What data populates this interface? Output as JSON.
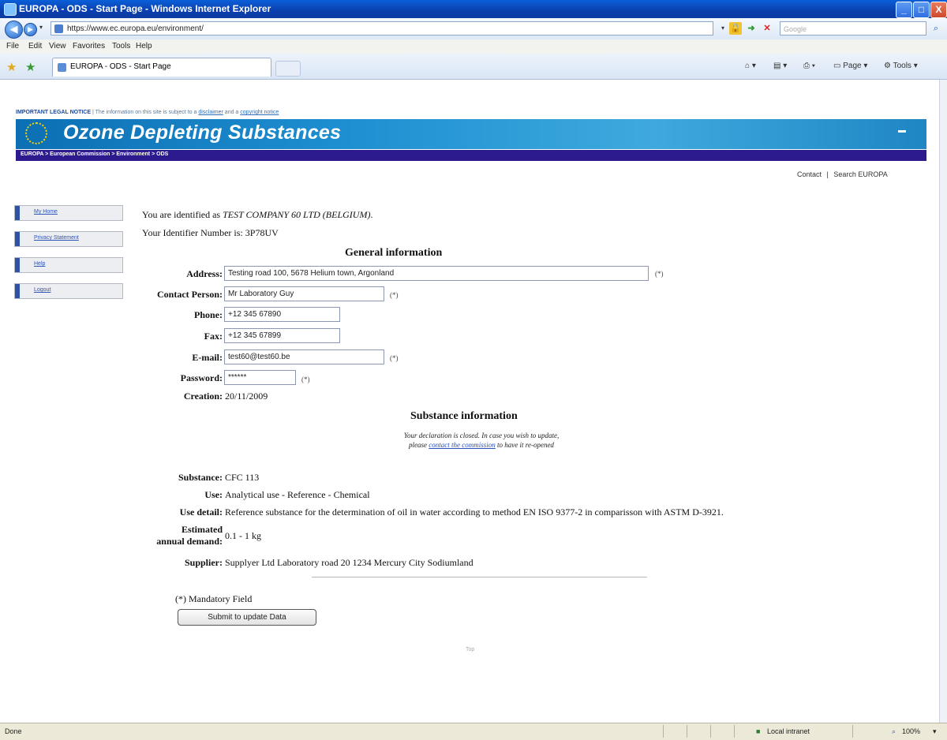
{
  "window": {
    "title": "EUROPA - ODS - Start Page - Windows Internet Explorer",
    "minimize": "_",
    "maximize": "□",
    "close": "X"
  },
  "addressbar": {
    "url": "https://www.ec.europa.eu/environment/",
    "search_placeholder": "Google"
  },
  "menu": [
    "File",
    "Edit",
    "View",
    "Favorites",
    "Tools",
    "Help"
  ],
  "tab": {
    "title": "EUROPA - ODS - Start Page"
  },
  "command_bar": {
    "page": "Page",
    "tools": "Tools"
  },
  "legal": {
    "label": "IMPORTANT LEGAL NOTICE",
    "text": " | The information on this site is subject to a ",
    "disclaimer": "disclaimer",
    "and": " and a ",
    "copyright": "copyright notice"
  },
  "banner": {
    "title": "Ozone Depleting Substances",
    "breadcrumb": "EUROPA > European Commission > Environment > ODS"
  },
  "toplinks": {
    "contact": "Contact",
    "separator": "|",
    "search": "Search EUROPA"
  },
  "sidebar": [
    {
      "label": "My Home"
    },
    {
      "label": "Privacy Statement"
    },
    {
      "label": "Help"
    },
    {
      "label": "Logout"
    }
  ],
  "identity": {
    "prefix": "You are identified as ",
    "company": "TEST COMPANY 60 LTD (BELGIUM)",
    "suffix": ".",
    "identifier_text": "Your Identifier Number is: 3P78UV"
  },
  "general": {
    "title": "General information",
    "address_label": "Address:",
    "address_value": "Testing road 100, 5678 Helium town, Argonland",
    "contact_label": "Contact Person:",
    "contact_value": "Mr Laboratory Guy",
    "phone_label": "Phone:",
    "phone_value": "+12 345 67890",
    "fax_label": "Fax:",
    "fax_value": "+12 345 67899",
    "email_label": "E-mail:",
    "email_value": "test60@test60.be",
    "password_label": "Password:",
    "password_value": "******",
    "creation_label": "Creation:",
    "creation_value": "20/11/2009",
    "mandatory_mark": "(*)"
  },
  "substance": {
    "title": "Substance information",
    "note_line1": "Your declaration is closed. In case you wish to update,",
    "note_pre": "please ",
    "note_link": "contact the commission",
    "note_post": " to have it re-opened",
    "substance_label": "Substance:",
    "substance_value": "CFC 113",
    "use_label": "Use:",
    "use_value": "Analytical use - Reference - Chemical",
    "use_detail_label": "Use detail:",
    "use_detail_value": "Reference substance for the determination of oil in water according to method EN ISO 9377-2 in comparisson with ASTM D-3921.",
    "demand_label_1": "Estimated",
    "demand_label_2": "annual demand:",
    "demand_value": "0.1 - 1 kg",
    "supplier_label": "Supplier:",
    "supplier_value": "Supplyer Ltd Laboratory road 20 1234 Mercury City Sodiumland"
  },
  "footer": {
    "mandatory": "(*) Mandatory Field",
    "submit": "Submit to update Data",
    "top": "Top"
  },
  "status": {
    "left": "Done",
    "zone": "Local intranet",
    "zoom": "100%"
  }
}
